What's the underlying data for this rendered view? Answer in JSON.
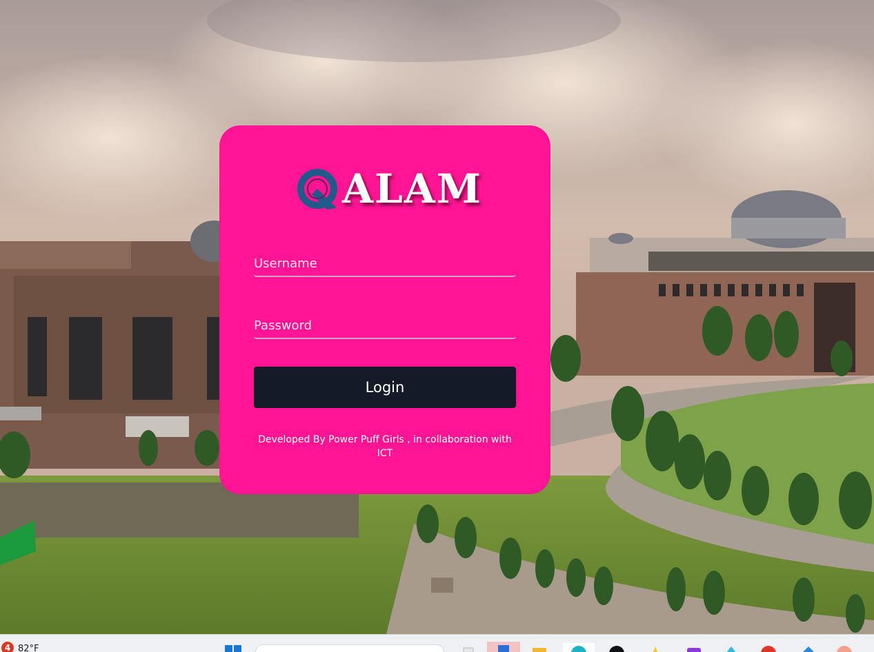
{
  "logo": {
    "text": "ALAM"
  },
  "form": {
    "username_placeholder": "Username",
    "password_placeholder": "Password",
    "login_label": "Login"
  },
  "footer": {
    "credit": "Developed By Power Puff Girls , in collaboration with ICT"
  },
  "taskbar": {
    "weather_badge": "4",
    "weather_temp": "82°F"
  },
  "colors": {
    "card": "#ff1493",
    "button": "#141a27",
    "logo_ring": "#1f5a8a"
  }
}
